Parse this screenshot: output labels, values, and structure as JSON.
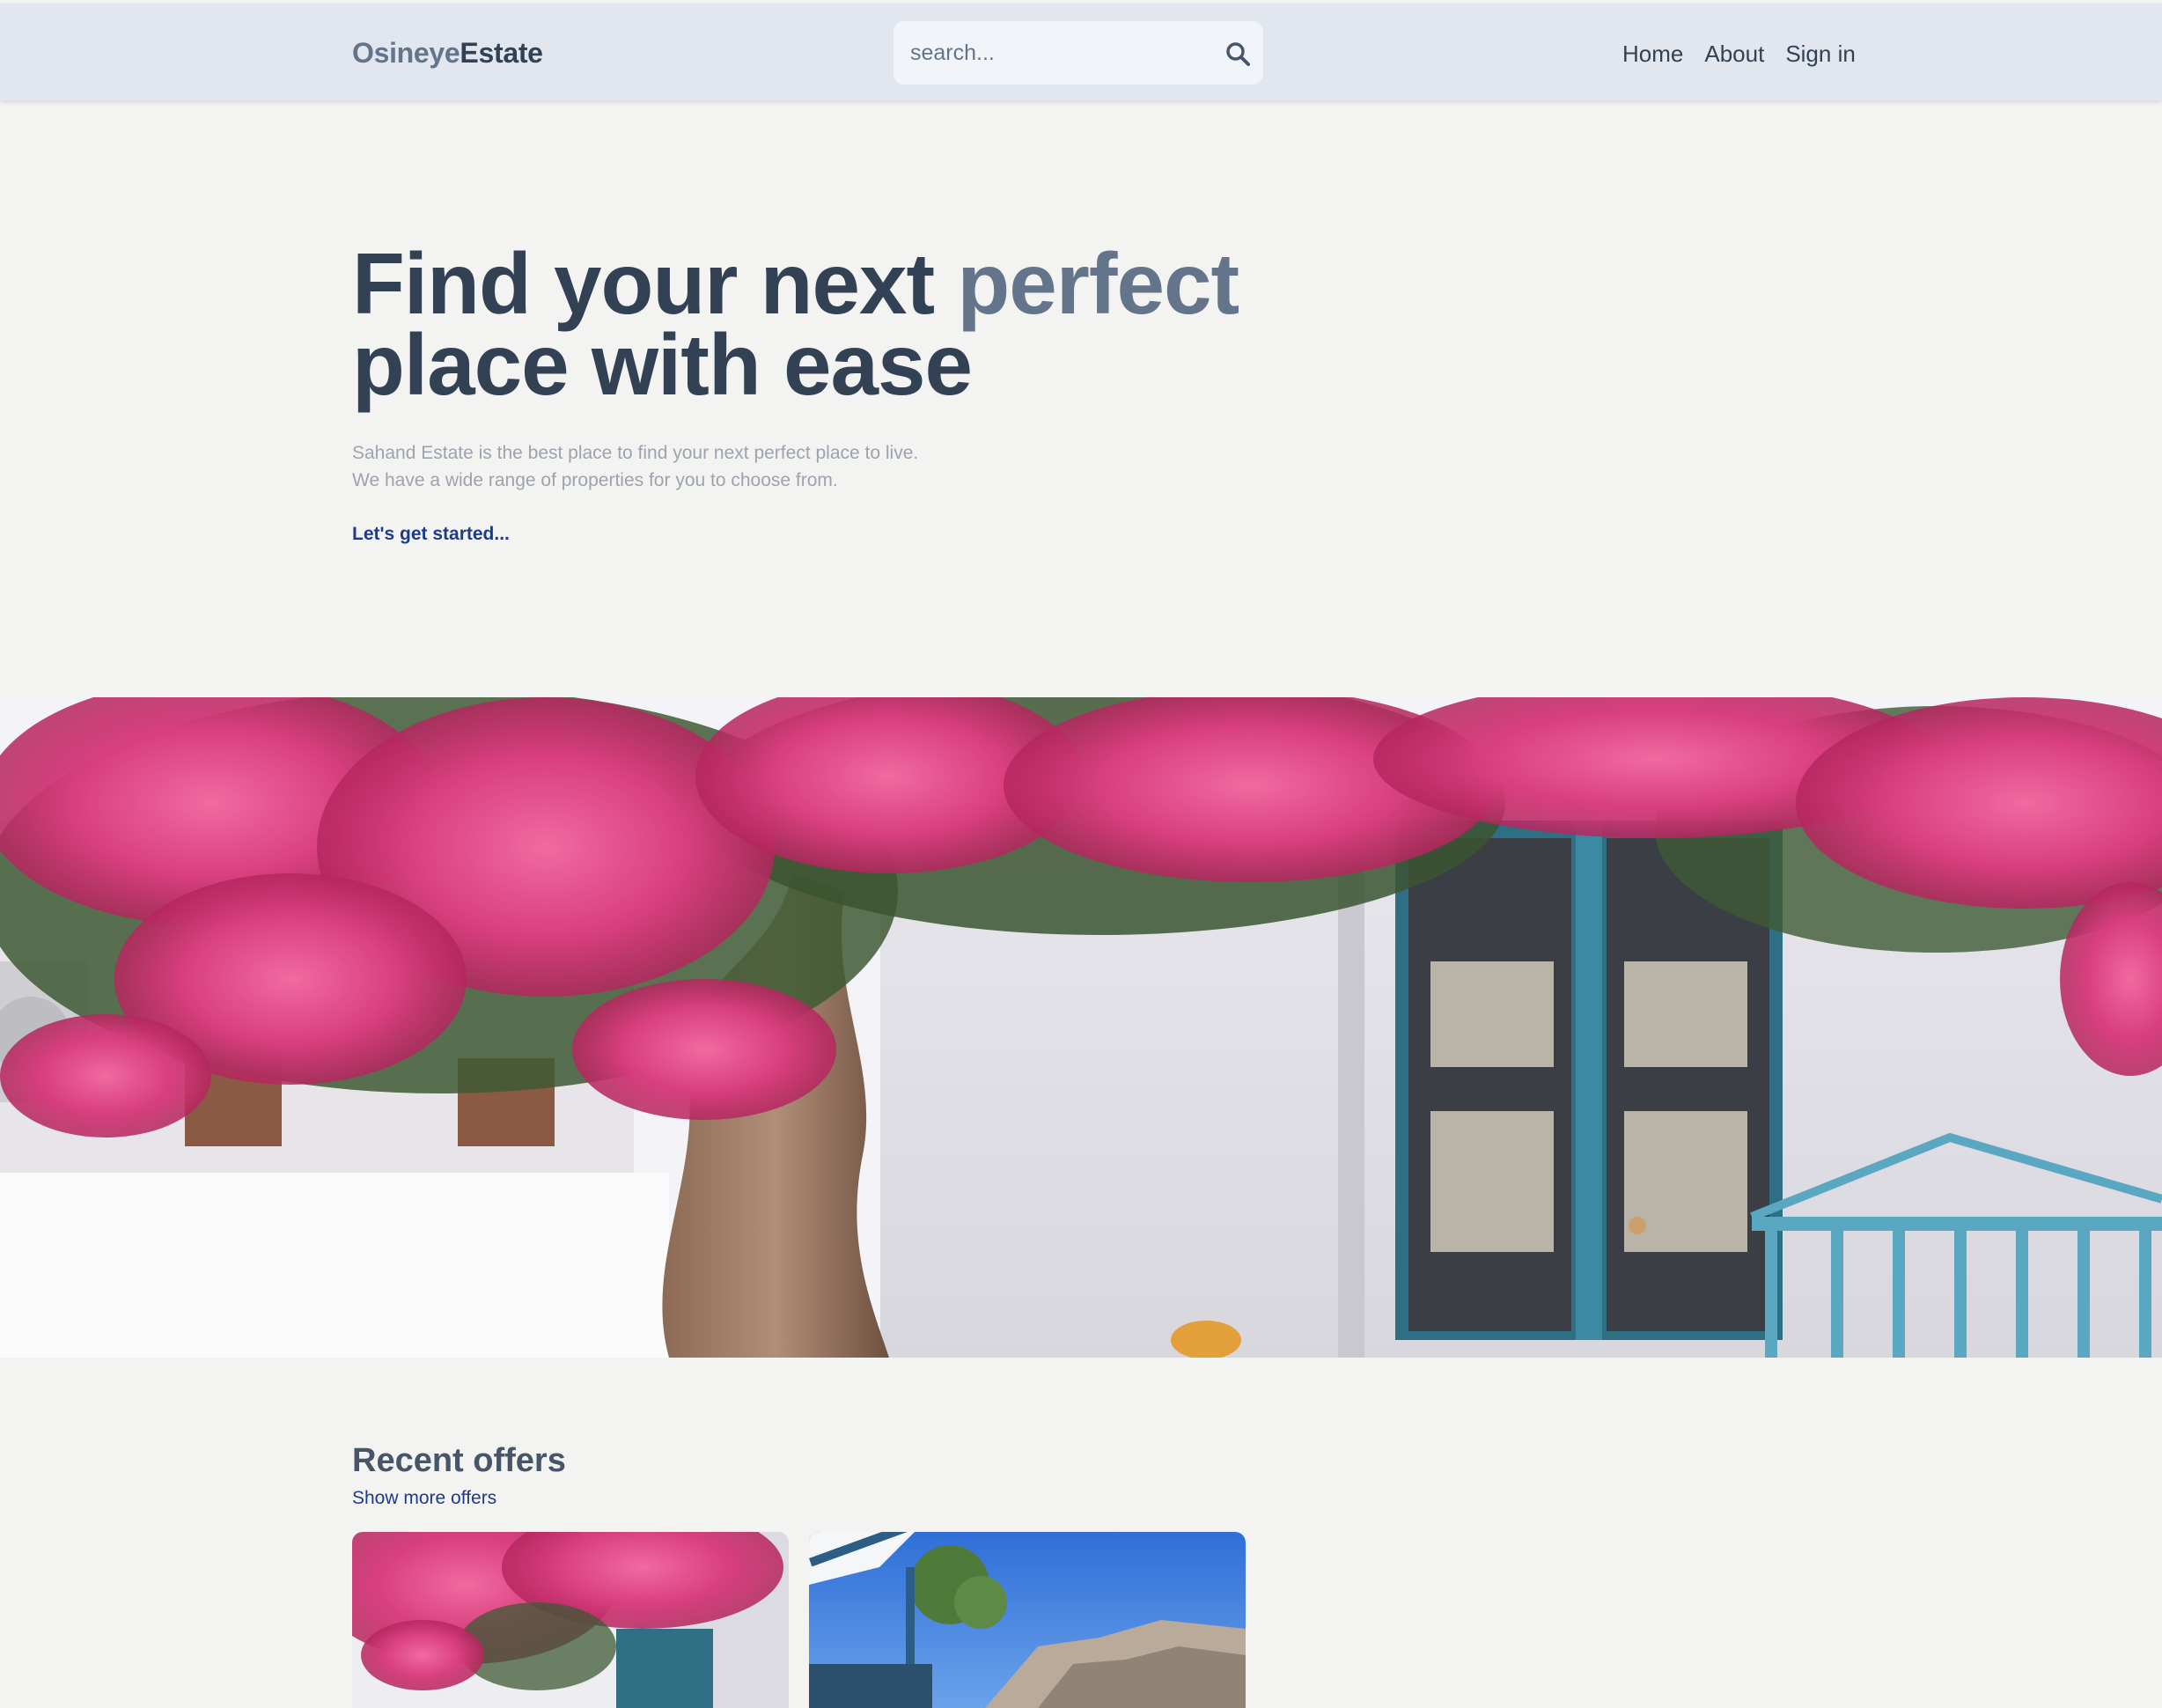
{
  "header": {
    "logo_part1": "Osineye",
    "logo_part2": "Estate",
    "search_placeholder": "search...",
    "search_icon": "search-icon",
    "nav": [
      "Home",
      "About",
      "Sign in"
    ]
  },
  "hero": {
    "title_part1": "Find your next ",
    "title_accent": "perfect",
    "title_part2": "place with ease",
    "subtitle_line1": "Sahand Estate is the best place to find your next perfect place to live.",
    "subtitle_line2": "We have a wide range of properties for you to choose from.",
    "cta": "Let's get started..."
  },
  "offers": {
    "title": "Recent offers",
    "link": "Show more offers"
  },
  "colors": {
    "header_bg": "#e2e7ef",
    "page_bg": "#f3f4f2",
    "title_dark": "#334155",
    "title_accent": "#64748b",
    "link_blue": "#1e3a8a"
  }
}
